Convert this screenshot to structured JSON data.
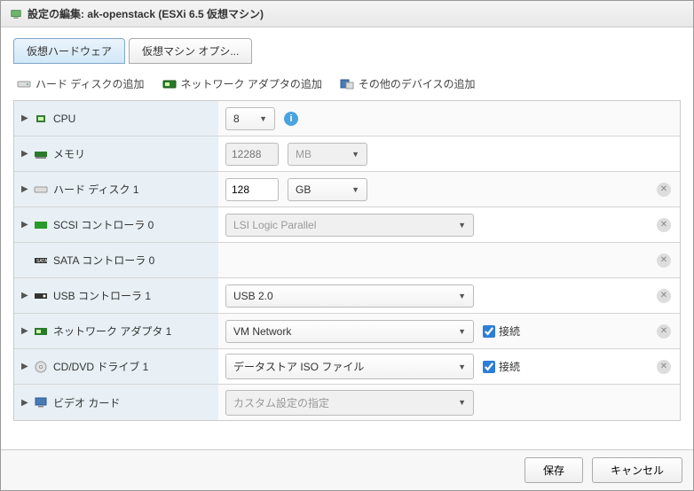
{
  "dialog": {
    "title": "設定の編集: ak-openstack (ESXi 6.5 仮想マシン)"
  },
  "tabs": {
    "hardware": "仮想ハードウェア",
    "options": "仮想マシン オプシ..."
  },
  "toolbar": {
    "add_disk": "ハード ディスクの追加",
    "add_nic": "ネットワーク アダプタの追加",
    "add_other": "その他のデバイスの追加"
  },
  "rows": {
    "cpu": {
      "label": "CPU",
      "value": "8"
    },
    "memory": {
      "label": "メモリ",
      "value": "12288",
      "unit": "MB"
    },
    "disk": {
      "label": "ハード ディスク 1",
      "value": "128",
      "unit": "GB"
    },
    "scsi": {
      "label": "SCSI コントローラ 0",
      "value": "LSI Logic Parallel"
    },
    "sata": {
      "label": "SATA コントローラ 0"
    },
    "usb": {
      "label": "USB コントローラ 1",
      "value": "USB 2.0"
    },
    "nic": {
      "label": "ネットワーク アダプタ 1",
      "value": "VM Network",
      "connect": "接続"
    },
    "cd": {
      "label": "CD/DVD ドライブ 1",
      "value": "データストア ISO ファイル",
      "connect": "接続"
    },
    "video": {
      "label": "ビデオ カード",
      "value": "カスタム設定の指定"
    }
  },
  "footer": {
    "save": "保存",
    "cancel": "キャンセル"
  }
}
